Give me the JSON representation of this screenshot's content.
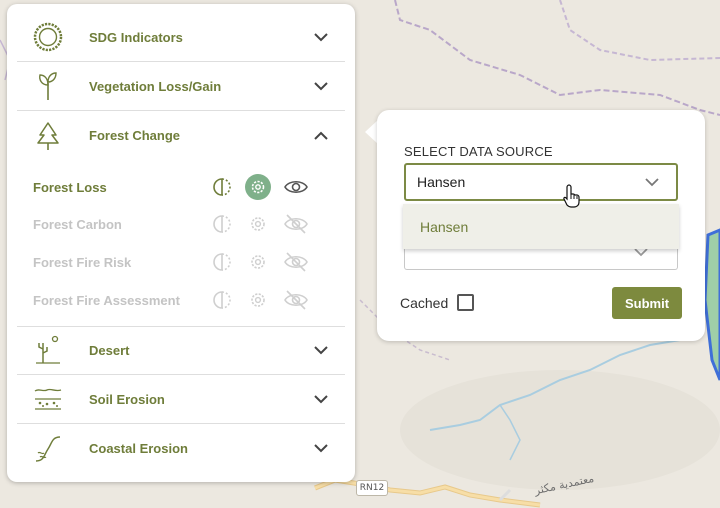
{
  "sidebar": {
    "categories": [
      {
        "label": "SDG Indicators",
        "icon": "sdg-wheel-icon",
        "expanded": false
      },
      {
        "label": "Vegetation Loss/Gain",
        "icon": "plant-icon",
        "expanded": false
      },
      {
        "label": "Forest Change",
        "icon": "tree-icon",
        "expanded": true
      },
      {
        "label": "Desert",
        "icon": "desert-icon",
        "expanded": false
      },
      {
        "label": "Soil Erosion",
        "icon": "soil-icon",
        "expanded": false
      },
      {
        "label": "Coastal Erosion",
        "icon": "coastal-icon",
        "expanded": false
      }
    ],
    "forest_change_items": [
      {
        "label": "Forest Loss",
        "active": true
      },
      {
        "label": "Forest Carbon",
        "active": false
      },
      {
        "label": "Forest Fire Risk",
        "active": false
      },
      {
        "label": "Forest Fire Assessment",
        "active": false
      }
    ]
  },
  "popup": {
    "data_source_label": "SELECT DATA SOURCE",
    "selected_value": "Hansen",
    "options": [
      "Hansen"
    ],
    "cached_label": "Cached",
    "cached_checked": false,
    "submit_label": "Submit"
  },
  "map": {
    "road_label": "RN12",
    "place_label": "معتمدية مكثر"
  },
  "colors": {
    "accent": "#7d8a3e",
    "label_active": "#6f7d3a",
    "label_inactive": "#c4c4c4",
    "gear_active_bg": "#7fb08a"
  }
}
